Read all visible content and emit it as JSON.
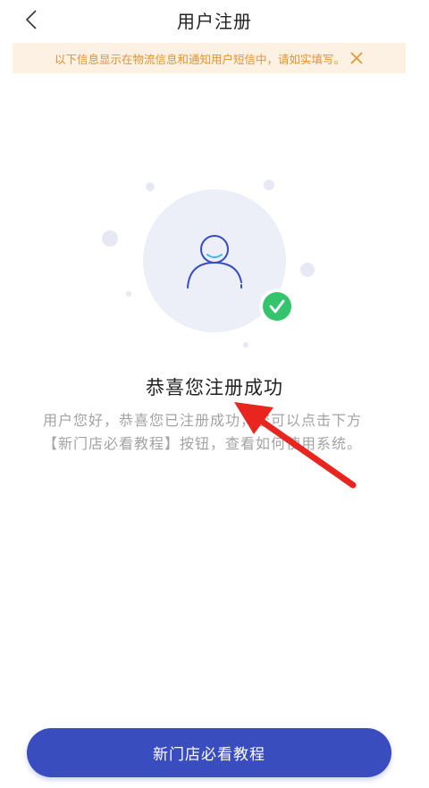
{
  "header": {
    "title": "用户注册"
  },
  "notice": {
    "text": "以下信息显示在物流信息和通知用户短信中，请如实填写。"
  },
  "success": {
    "title": "恭喜您注册成功",
    "description": "用户您好，恭喜您已注册成功，您可以点击下方【新门店必看教程】按钮，查看如何使用系统。"
  },
  "button": {
    "label": "新门店必看教程"
  },
  "colors": {
    "primary": "#3a4dbf",
    "notice_bg": "#fdf1e3",
    "notice_text": "#e4932f",
    "success_green": "#35c46e",
    "arrow_red": "#e8251f"
  }
}
